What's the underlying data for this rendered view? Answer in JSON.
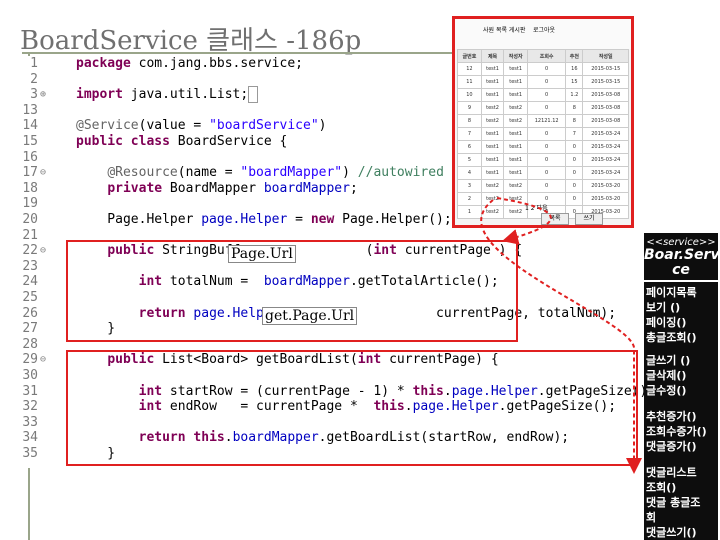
{
  "slide": {
    "title": "BoardService 클래스 -186p"
  },
  "code": {
    "lines": [
      {
        "ln": "1",
        "fold": "",
        "html": "<span class='kw'>package</span> com.jang.bbs.service;"
      },
      {
        "ln": "2",
        "fold": "",
        "html": ""
      },
      {
        "ln": "3",
        "fold": "⊕",
        "html": "<span class='kw'>import</span> java.util.List;<span style='border:1px solid #999'>&nbsp;</span>"
      },
      {
        "ln": "13",
        "fold": "",
        "html": ""
      },
      {
        "ln": "14",
        "fold": "",
        "html": "<span class='an'>@Service</span>(value = <span class='st'>\"boardService\"</span>)"
      },
      {
        "ln": "15",
        "fold": "",
        "html": "<span class='kw'>public class</span> BoardService {"
      },
      {
        "ln": "16",
        "fold": "",
        "html": ""
      },
      {
        "ln": "17",
        "fold": "⊖",
        "html": "    <span class='an'>@Resource</span>(name = <span class='st'>\"boardMapper\"</span>) <span class='cm'>//autowired</span>"
      },
      {
        "ln": "18",
        "fold": "",
        "html": "    <span class='kw'>private</span> BoardMapper <span class='fd'>boardMapper</span>;"
      },
      {
        "ln": "19",
        "fold": "",
        "html": ""
      },
      {
        "ln": "20",
        "fold": "",
        "html": "    Page.Helper <span class='fd'>page.Helper</span> = <span class='kw'>new</span> Page.Helper();"
      },
      {
        "ln": "21",
        "fold": "",
        "html": ""
      },
      {
        "ln": "22",
        "fold": "⊖",
        "html": "    <span class='kw'>public</span> StringBuffer              (<span class='kw'>int</span> currentPage ) {"
      },
      {
        "ln": "23",
        "fold": "",
        "html": ""
      },
      {
        "ln": "24",
        "fold": "",
        "html": "        <span class='kw'>int</span> totalNum =  <span class='fd'>boardMapper</span>.getTotalArticle();"
      },
      {
        "ln": "25",
        "fold": "",
        "html": ""
      },
      {
        "ln": "26",
        "fold": "",
        "html": "        <span class='kw'>return</span> <span class='fd'>page.Helper</span>.                   currentPage, totalNum);"
      },
      {
        "ln": "27",
        "fold": "",
        "html": "    }"
      },
      {
        "ln": "28",
        "fold": "",
        "html": ""
      },
      {
        "ln": "29",
        "fold": "⊖",
        "html": "    <span class='kw'>public</span> List&lt;Board&gt; getBoardList(<span class='kw'>int</span> currentPage) {"
      },
      {
        "ln": "30",
        "fold": "",
        "html": ""
      },
      {
        "ln": "31",
        "fold": "",
        "html": "        <span class='kw'>int</span> startRow = (currentPage - 1) * <span class='kw'>this</span>.<span class='fd'>page.Helper</span>.getPageSize()+1 ;"
      },
      {
        "ln": "32",
        "fold": "",
        "html": "        <span class='kw'>int</span> endRow   = currentPage *  <span class='kw'>this</span>.<span class='fd'>page.Helper</span>.getPageSize();"
      },
      {
        "ln": "33",
        "fold": "",
        "html": ""
      },
      {
        "ln": "34",
        "fold": "",
        "html": "        <span class='kw'>return</span> <span class='kw'>this</span>.<span class='fd'>boardMapper</span>.getBoardList(startRow, endRow);"
      },
      {
        "ln": "35",
        "fold": "",
        "html": "    }"
      }
    ],
    "overlay_pageurl": "Page.Url",
    "overlay_getpageurl": "get.Page.Url"
  },
  "screenshot": {
    "tabs": [
      "사원 목록 게시판",
      "로그아웃"
    ],
    "headers": [
      "글번호",
      "제목",
      "작성자",
      "조회수",
      "추천",
      "작성일"
    ],
    "rows": [
      [
        "12",
        "test1",
        "test1",
        "0",
        "16",
        "2015-03-15"
      ],
      [
        "11",
        "test1",
        "test1",
        "0",
        "15",
        "2015-03-15"
      ],
      [
        "10",
        "test1",
        "test1",
        "0",
        "1.2",
        "2015-03-08"
      ],
      [
        "9",
        "test2",
        "test2",
        "0",
        "8",
        "2015-03-08"
      ],
      [
        "8",
        "test2",
        "test2",
        "12121.12",
        "8",
        "2015-03-08"
      ],
      [
        "7",
        "test1",
        "test1",
        "0",
        "7",
        "2015-03-24"
      ],
      [
        "6",
        "test1",
        "test1",
        "0",
        "0",
        "2015-03-24"
      ],
      [
        "5",
        "test1",
        "test1",
        "0",
        "0",
        "2015-03-24"
      ],
      [
        "4",
        "test1",
        "test1",
        "0",
        "0",
        "2015-03-24"
      ],
      [
        "3",
        "test2",
        "test2",
        "0",
        "0",
        "2015-03-20"
      ],
      [
        "2",
        "test2",
        "test2",
        "0",
        "0",
        "2015-03-20"
      ],
      [
        "1",
        "test2",
        "test2",
        "0",
        "0",
        "2015-03-20"
      ]
    ],
    "pagination": "1 2 다음",
    "buttons": [
      "목록",
      "쓰기"
    ]
  },
  "service_box": {
    "stereotype": "<<service>>",
    "name": "Boar.Servi ce",
    "group1": [
      "페이지목록",
      "보기 ()",
      "페이징()",
      "총글조회()"
    ],
    "group2": [
      "글쓰기 ()",
      "글삭제()",
      "글수정()"
    ],
    "group3": [
      "추천증가()",
      "조회수증가()",
      "댓글증가()"
    ],
    "group4": [
      "댓글리스트",
      "조회()",
      "댓글 총글조",
      "회",
      "댓글쓰기()"
    ]
  }
}
